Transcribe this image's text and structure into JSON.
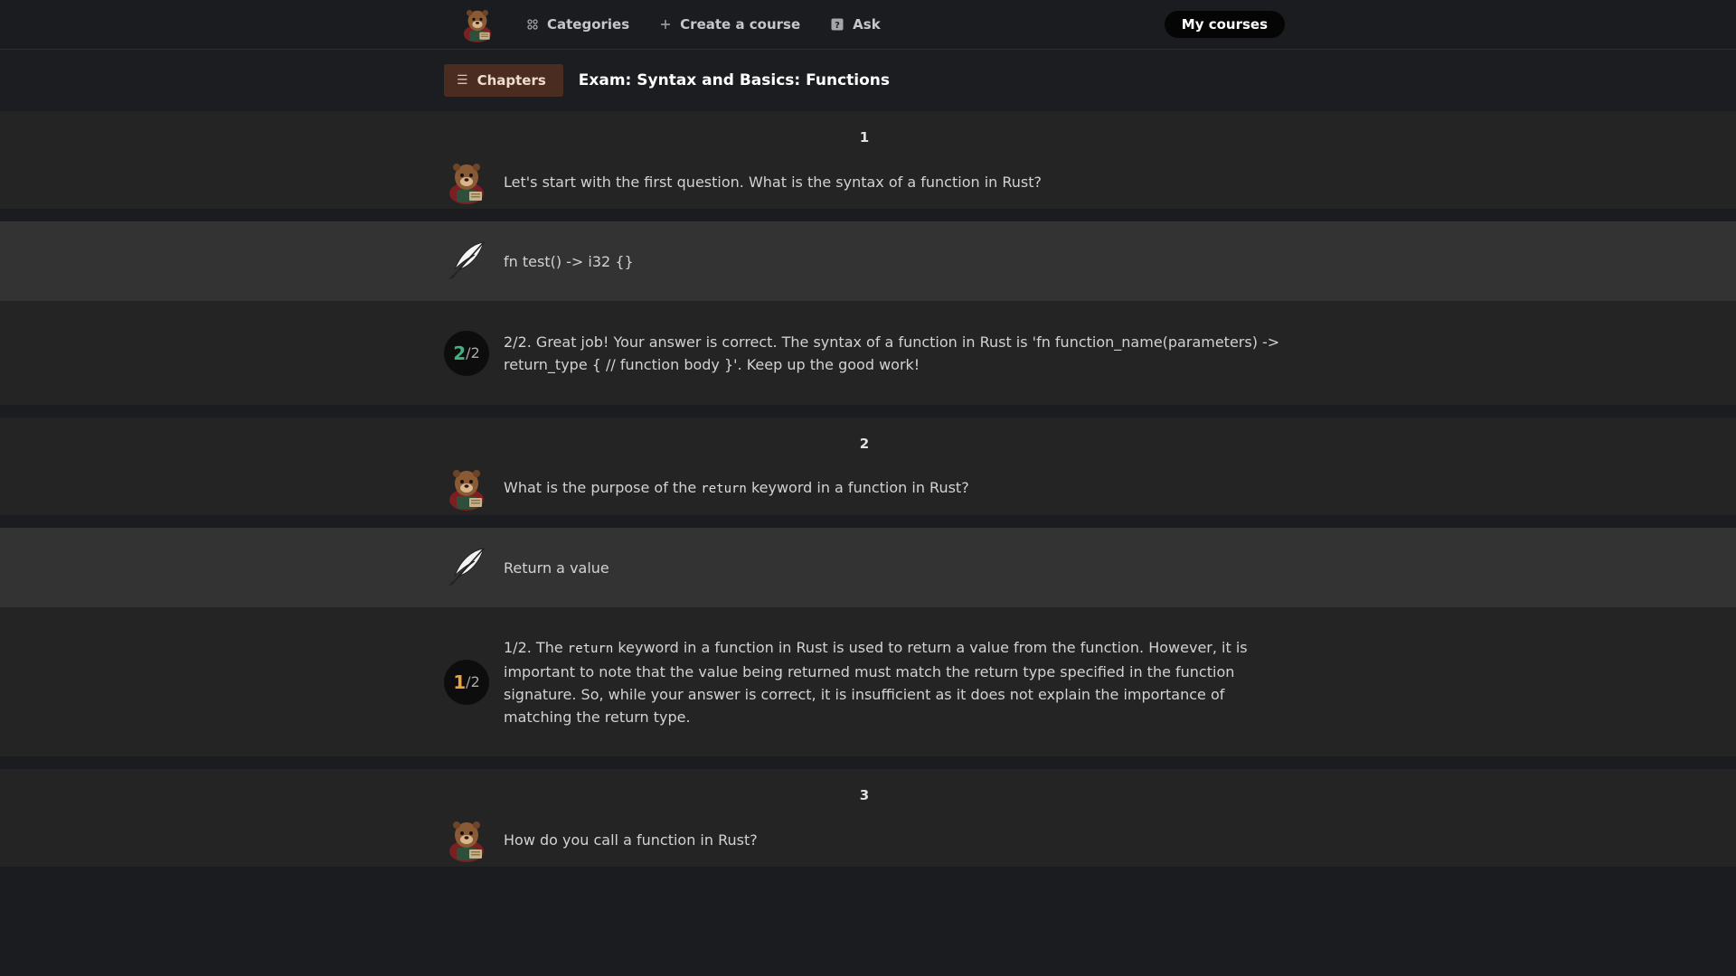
{
  "nav": {
    "categories": "Categories",
    "create_course": "Create a course",
    "ask": "Ask",
    "my_courses": "My courses"
  },
  "header": {
    "chapters_label": "Chapters",
    "exam_title": "Exam: Syntax and Basics: Functions"
  },
  "questions": [
    {
      "number": "1",
      "question": "Let's start with the first question. What is the syntax of a function in Rust?",
      "answer": "fn test() -> i32 {}",
      "score": {
        "earned": "2",
        "total": "/2",
        "color": "#3fb27f"
      },
      "feedback": "2/2. Great job! Your answer is correct. The syntax of a function in Rust is 'fn function_name(parameters) -> return_type { // function body }'. Keep up the good work!"
    },
    {
      "number": "2",
      "question_pre": "What is the purpose of the ",
      "question_code": "return",
      "question_post": " keyword in a function in Rust?",
      "answer": "Return a value",
      "score": {
        "earned": "1",
        "total": "/2",
        "color": "#f0a23a"
      },
      "feedback_pre": "1/2. The ",
      "feedback_code": "return",
      "feedback_post": " keyword in a function in Rust is used to return a value from the function. However, it is important to note that the value being returned must match the return type specified in the function signature. So, while your answer is correct, it is insufficient as it does not explain the importance of matching the return type."
    },
    {
      "number": "3",
      "question": "How do you call a function in Rust?"
    }
  ]
}
